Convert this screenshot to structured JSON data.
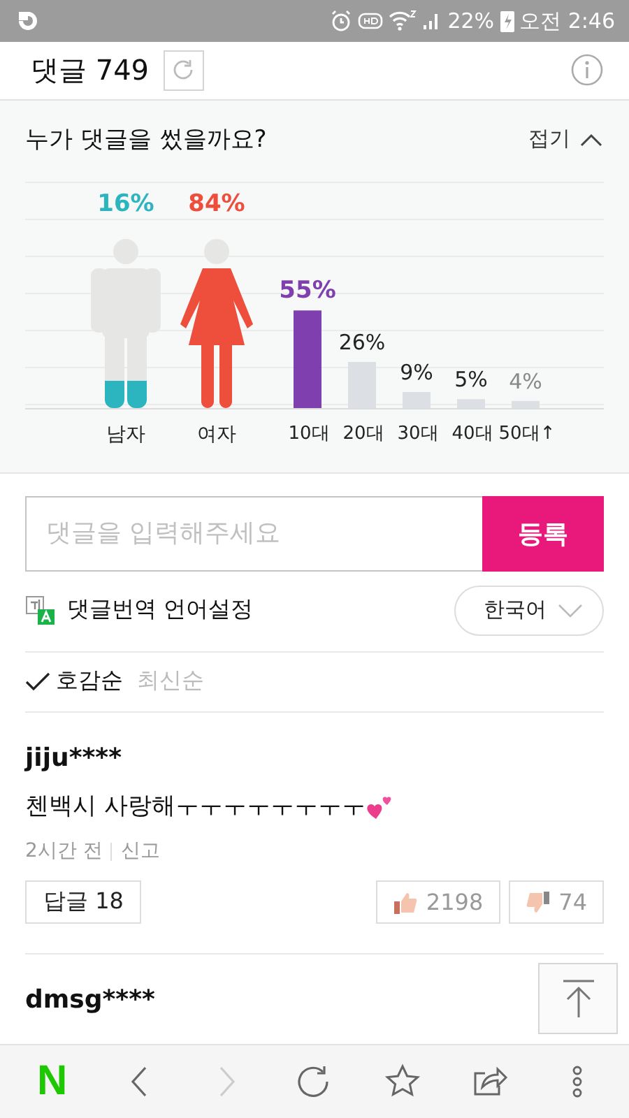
{
  "status_bar": {
    "battery": "22%",
    "time": "오전 2:46"
  },
  "header": {
    "title": "댓글 749"
  },
  "stats": {
    "title": "누가 댓글을 썼을까요?",
    "toggle": "접기",
    "expanded": true,
    "gender": [
      {
        "label": "남자",
        "percent": "16%",
        "level": 0.16,
        "color": "#2cb5bf"
      },
      {
        "label": "여자",
        "percent": "84%",
        "level": 0.84,
        "color": "#ee4f3c"
      }
    ],
    "age_chart": {
      "chart_data": {
        "type": "bar",
        "categories": [
          "10대",
          "20대",
          "30대",
          "40대",
          "50대↑"
        ],
        "values": [
          55,
          26,
          9,
          5,
          4
        ],
        "value_labels": [
          "55%",
          "26%",
          "9%",
          "5%",
          "4%"
        ]
      }
    }
  },
  "composer": {
    "placeholder": "댓글을 입력해주세요",
    "submit": "등록"
  },
  "translation": {
    "label": "댓글번역 언어설정",
    "language": "한국어"
  },
  "sort": [
    {
      "label": "호감순",
      "selected": true
    },
    {
      "label": "최신순",
      "selected": false
    }
  ],
  "comments": [
    {
      "user": "jiju****",
      "text": "첸백시 사랑해ㅜㅜㅜㅜㅜㅜㅜㅜ",
      "time": "2시간 전",
      "report": "신고",
      "replies": "답글 18",
      "likes": "2198",
      "dislikes": "74"
    },
    {
      "user": "dmsg****"
    }
  ],
  "nav": {
    "logo": "N",
    "buttons": [
      {
        "kind": "back",
        "disabled": false
      },
      {
        "kind": "forward",
        "disabled": true
      },
      {
        "kind": "reload",
        "disabled": false
      },
      {
        "kind": "bookmark",
        "disabled": false
      },
      {
        "kind": "share",
        "disabled": false
      },
      {
        "kind": "more",
        "disabled": false
      }
    ]
  }
}
